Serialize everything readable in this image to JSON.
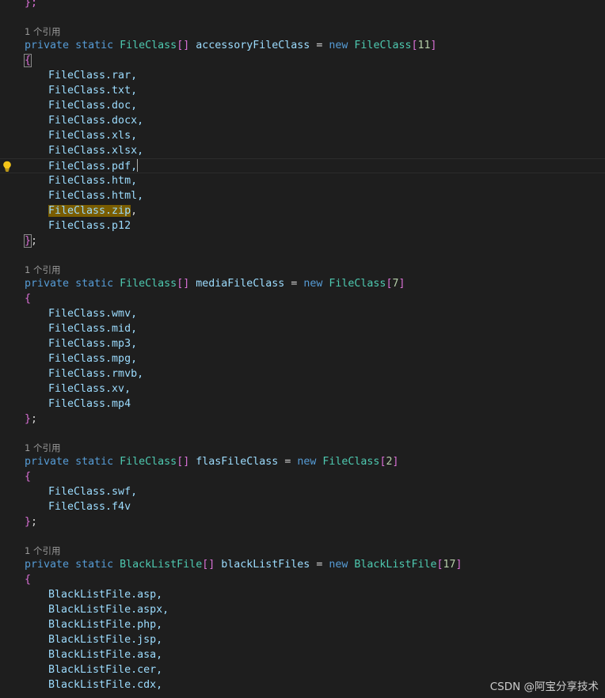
{
  "lens_text": "1 个引用",
  "keywords": {
    "private": "private",
    "static": "static",
    "new": "new"
  },
  "prev_close": "};",
  "blocks": [
    {
      "type": "FileClass",
      "name": "accessoryFileClass",
      "size": "11",
      "items": [
        "FileClass.rar,",
        "FileClass.txt,",
        "FileClass.doc,",
        "FileClass.docx,",
        "FileClass.xls,",
        "FileClass.xlsx,",
        "FileClass.pdf,",
        "FileClass.htm,",
        "FileClass.html,",
        "FileClass.zip",
        "FileClass.p12"
      ],
      "highlighted_item": "FileClass.zip",
      "current_line_item": "FileClass.pdf,"
    },
    {
      "type": "FileClass",
      "name": "mediaFileClass",
      "size": "7",
      "items": [
        "FileClass.wmv,",
        "FileClass.mid,",
        "FileClass.mp3,",
        "FileClass.mpg,",
        "FileClass.rmvb,",
        "FileClass.xv,",
        "FileClass.mp4"
      ]
    },
    {
      "type": "FileClass",
      "name": "flasFileClass",
      "size": "2",
      "items": [
        "FileClass.swf,",
        "FileClass.f4v"
      ]
    },
    {
      "type": "BlackListFile",
      "name": "blackListFiles",
      "size": "17",
      "items": [
        "BlackListFile.asp,",
        "BlackListFile.aspx,",
        "BlackListFile.php,",
        "BlackListFile.jsp,",
        "BlackListFile.asa,",
        "BlackListFile.cer,",
        "BlackListFile.cdx,"
      ]
    }
  ],
  "block0_zip_comma": ",",
  "watermark": "CSDN @阿宝分享技术",
  "icons": {
    "gutter": "lightbulb-icon"
  },
  "colors": {
    "background": "#1e1e1e",
    "keyword": "#569cd6",
    "type": "#4ec9b0",
    "identifier": "#9cdcfe",
    "number": "#b5cea8",
    "bracket_level1": "#ffd700",
    "bracket_level2": "#da70d6",
    "find_highlight": "#7a5d00"
  }
}
